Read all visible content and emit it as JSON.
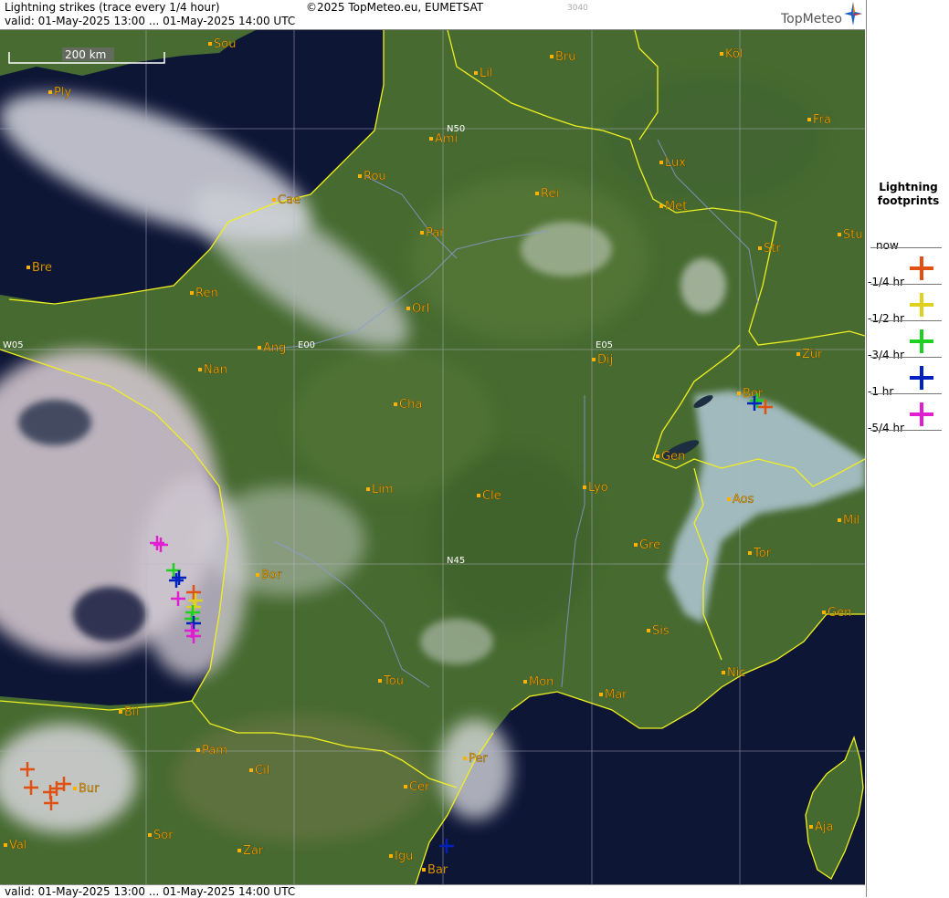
{
  "header": {
    "title": "Lightning strikes (trace every 1/4 hour)",
    "copyright": "©2025 TopMeteo.eu, EUMETSAT",
    "code": "3040",
    "valid": "valid:  01-May-2025 13:00 ... 01-May-2025 14:00 UTC",
    "logo": "TopMeteo"
  },
  "footer": {
    "valid": "valid:  01-May-2025 13:00 ... 01-May-2025 14:00 UTC"
  },
  "scale": {
    "label": "200 km"
  },
  "grid_labels": [
    "N50",
    "N45",
    "W05",
    "E00",
    "E05"
  ],
  "cities": [
    "Sou",
    "Ply",
    "Lil",
    "Bru",
    "Köl",
    "Ami",
    "Fra",
    "Rou",
    "Lux",
    "Cae",
    "Rei",
    "Met",
    "Par",
    "Stu",
    "Bre",
    "Str",
    "Ren",
    "Orl",
    "Ang",
    "Zür",
    "Nan",
    "Dij",
    "Ber",
    "Cha",
    "Gen",
    "Lim",
    "Cle",
    "Lyo",
    "Aos",
    "Mil",
    "Gre",
    "Tor",
    "Bor",
    "Gen",
    "Sis",
    "Nic",
    "Tou",
    "Mon",
    "Mar",
    "Bil",
    "Pam",
    "Cil",
    "Per",
    "Bur",
    "Cer",
    "Aja",
    "Sor",
    "Val",
    "Zar",
    "Igu",
    "Bar"
  ],
  "legend": {
    "title": "Lightning footprints",
    "rows": [
      {
        "label": "now",
        "color": ""
      },
      {
        "label": "-1/4 hr",
        "color": "#e05010"
      },
      {
        "label": "-1/2 hr",
        "color": "#e0d020"
      },
      {
        "label": "-3/4 hr",
        "color": "#20d020"
      },
      {
        "label": "-1 hr",
        "color": "#0020c0"
      },
      {
        "label": "-5/4 hr",
        "color": "#e020d0"
      }
    ]
  },
  "strike_colors": {
    "q1": "#e05010",
    "q2": "#e0d020",
    "q3": "#20d020",
    "q4": "#0020c0",
    "q5": "#e020d0"
  }
}
